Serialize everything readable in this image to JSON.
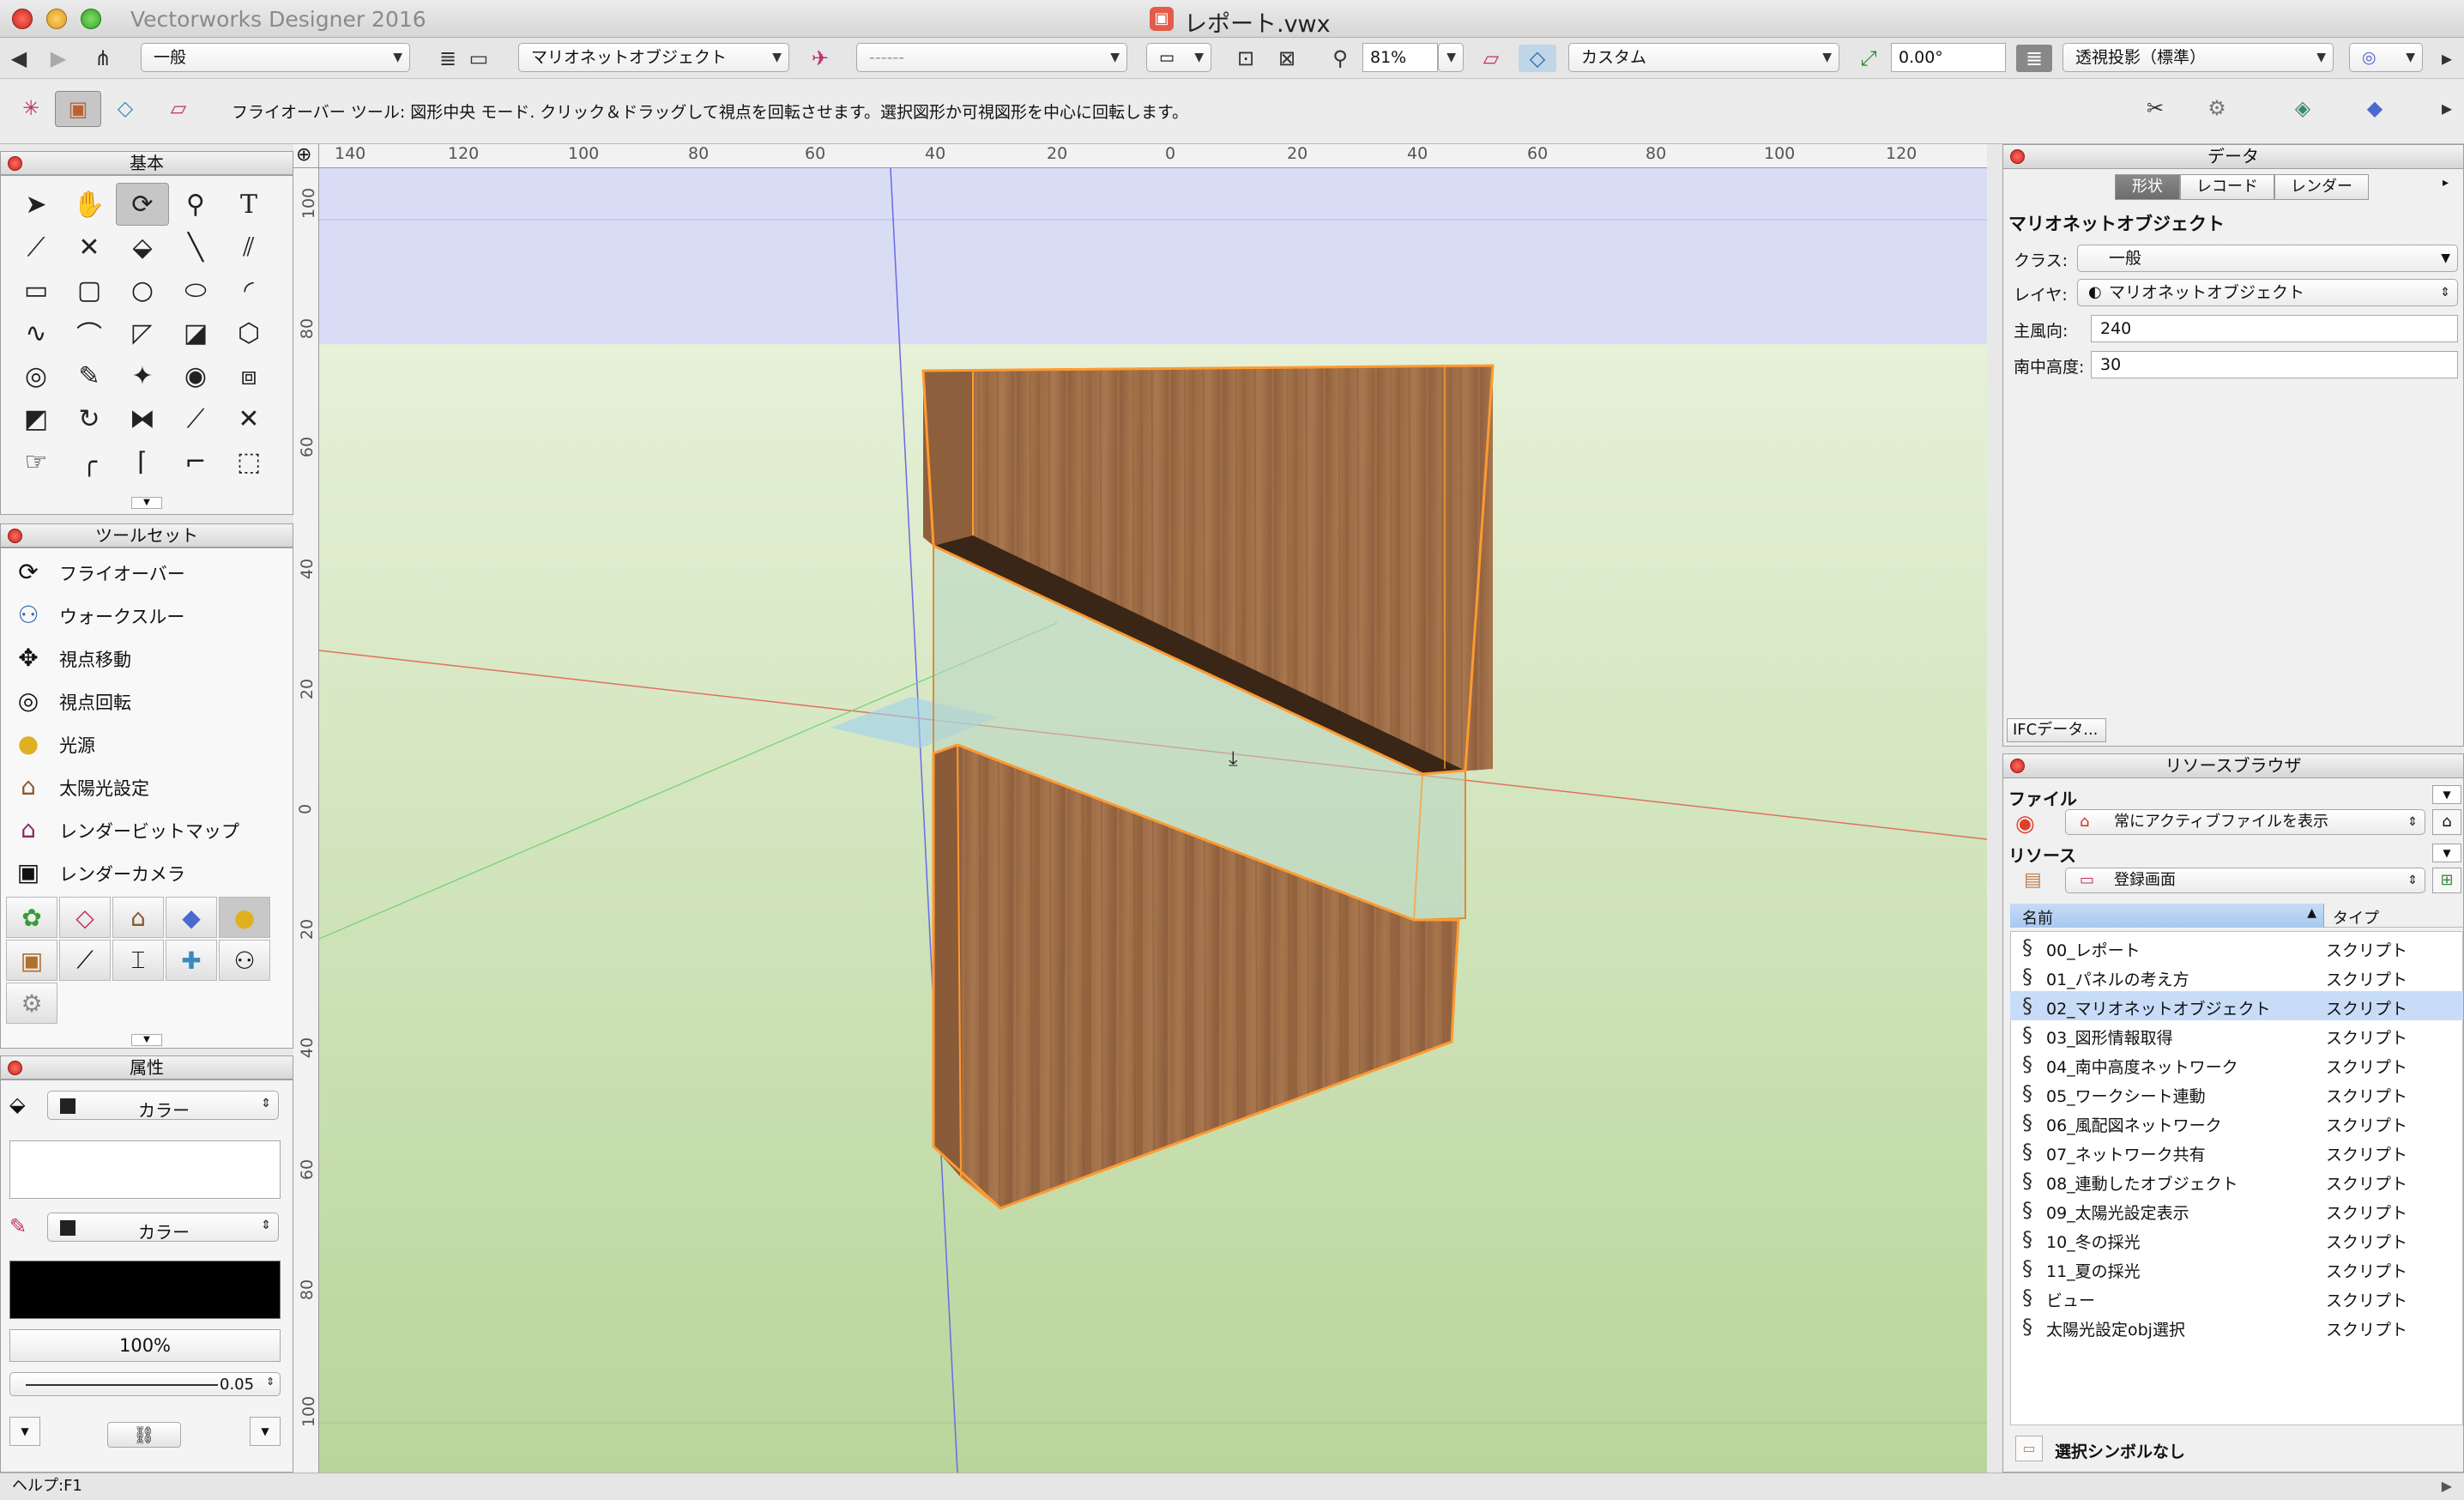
{
  "window": {
    "app_title": "Vectorworks Designer 2016",
    "doc_title": "レポート.vwx"
  },
  "toolbar": {
    "class_popup": "一般",
    "layer_popup": "マリオネットオブジェクト",
    "sheet_popup": "------",
    "zoom": "81%",
    "view_popup": "カスタム",
    "angle": "0.00°",
    "projection_popup": "透視投影（標準）"
  },
  "mode_bar": {
    "message": "フライオーバー ツール: 図形中央 モード. クリック＆ドラッグして視点を回転させます。選択図形か可視図形を中心に回転します。"
  },
  "left": {
    "basic_title": "基本",
    "toolset_title": "ツールセット",
    "toolset_items": [
      {
        "label": "フライオーバー",
        "icon": "flyover-icon"
      },
      {
        "label": "ウォークスルー",
        "icon": "walkthrough-icon"
      },
      {
        "label": "視点移動",
        "icon": "move-view-icon"
      },
      {
        "label": "視点回転",
        "icon": "rotate-view-icon"
      },
      {
        "label": "光源",
        "icon": "light-icon"
      },
      {
        "label": "太陽光設定",
        "icon": "sun-settings-icon"
      },
      {
        "label": "レンダービットマップ",
        "icon": "render-bitmap-icon"
      },
      {
        "label": "レンダーカメラ",
        "icon": "render-camera-icon"
      }
    ],
    "attr_title": "属性",
    "fill_popup": "カラー",
    "pen_popup": "カラー",
    "opacity": "100%",
    "line_weight": "0.05"
  },
  "rulers": {
    "top": [
      "140",
      "120",
      "100",
      "80",
      "60",
      "40",
      "20",
      "0",
      "20",
      "40",
      "60",
      "80",
      "100",
      "120"
    ],
    "left": [
      "100",
      "80",
      "60",
      "40",
      "20",
      "0",
      "20",
      "40",
      "60",
      "80",
      "100"
    ]
  },
  "data_palette": {
    "title": "データ",
    "tabs": [
      "形状",
      "レコード",
      "レンダー"
    ],
    "object_type": "マリオネットオブジェクト",
    "class_label": "クラス:",
    "class_value": "一般",
    "layer_label": "レイヤ:",
    "layer_value": "マリオネットオブジェクト",
    "azimuth_label": "主風向:",
    "azimuth_value": "240",
    "altitude_label": "南中高度:",
    "altitude_value": "30",
    "ifc_button": "IFCデータ..."
  },
  "resource_browser": {
    "title": "リソースブラウザ",
    "file_label": "ファイル",
    "file_popup": "常にアクティブファイルを表示",
    "resource_label": "リソース",
    "resource_popup": "登録画面",
    "col_name": "名前",
    "col_type": "タイプ",
    "rows": [
      {
        "name": "00_レポート",
        "type": "スクリプト"
      },
      {
        "name": "01_パネルの考え方",
        "type": "スクリプト"
      },
      {
        "name": "02_マリオネットオブジェクト",
        "type": "スクリプト"
      },
      {
        "name": "03_図形情報取得",
        "type": "スクリプト"
      },
      {
        "name": "04_南中高度ネットワーク",
        "type": "スクリプト"
      },
      {
        "name": "05_ワークシート連動",
        "type": "スクリプト"
      },
      {
        "name": "06_風配図ネットワーク",
        "type": "スクリプト"
      },
      {
        "name": "07_ネットワーク共有",
        "type": "スクリプト"
      },
      {
        "name": "08_連動したオブジェクト",
        "type": "スクリプト"
      },
      {
        "name": "09_太陽光設定表示",
        "type": "スクリプト"
      },
      {
        "name": "10_冬の採光",
        "type": "スクリプト"
      },
      {
        "name": "11_夏の採光",
        "type": "スクリプト"
      },
      {
        "name": "ビュー",
        "type": "スクリプト"
      },
      {
        "name": "太陽光設定obj選択",
        "type": "スクリプト"
      }
    ],
    "selected_index": 2,
    "footer": "選択シンボルなし"
  },
  "status": {
    "help": "ヘルプ:F1"
  }
}
